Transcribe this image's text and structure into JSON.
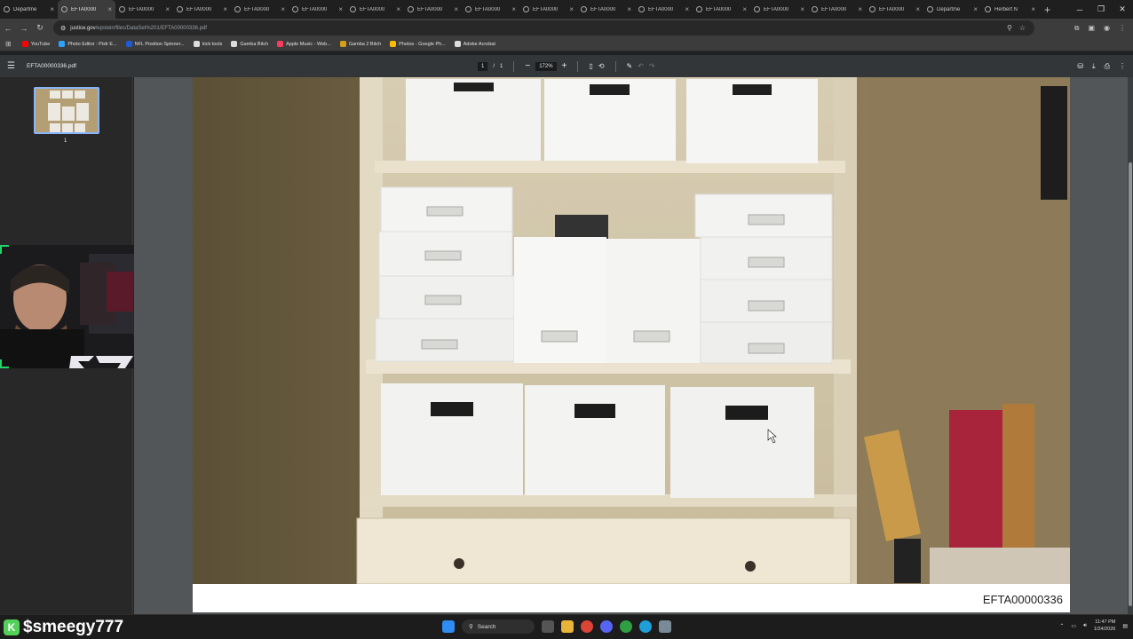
{
  "browser": {
    "tabs": [
      {
        "title": "Departme"
      },
      {
        "title": "EFTA0000"
      },
      {
        "title": "EFTA0000"
      },
      {
        "title": "EFTA0000"
      },
      {
        "title": "EFTA0000"
      },
      {
        "title": "EFTA0000"
      },
      {
        "title": "EFTA0000"
      },
      {
        "title": "EFTA0000"
      },
      {
        "title": "EFTA0000"
      },
      {
        "title": "EFTA0000"
      },
      {
        "title": "EFTA0000"
      },
      {
        "title": "EFTA0000"
      },
      {
        "title": "EFTA0000"
      },
      {
        "title": "EFTA0000"
      },
      {
        "title": "EFTA0000"
      },
      {
        "title": "EFTA0000"
      },
      {
        "title": "Departme"
      },
      {
        "title": "Herbert N"
      }
    ],
    "active_tab_index": 1,
    "url_domain": "justice.gov",
    "url_path": "/epstein/files/DataSet%201/EFTA00000336.pdf",
    "bookmarks": [
      {
        "label": "YouTube",
        "color": "#ff0000"
      },
      {
        "label": "Photo Editor : Pixlr E...",
        "color": "#2aa3ff"
      },
      {
        "label": "NFL Position Spinner...",
        "color": "#1e5bd6"
      },
      {
        "label": "kick tools",
        "color": "#dddddd"
      },
      {
        "label": "Gamba Bitch",
        "color": "#dddddd"
      },
      {
        "label": "Apple Music - Web...",
        "color": "#fa3b5b"
      },
      {
        "label": "Gamba 2 Bitch",
        "color": "#d4a017"
      },
      {
        "label": "Photos - Google Ph...",
        "color": "#fbbc05"
      },
      {
        "label": "Adobe Acrobat",
        "color": "#dddddd"
      }
    ]
  },
  "pdf": {
    "filename": "EFTA00000336.pdf",
    "current_page": "1",
    "page_separator": "/",
    "total_pages": "1",
    "zoom": "172%",
    "thumbnail_label": "1",
    "page_footer_label": "EFTA00000336"
  },
  "stream": {
    "webcam_counter": "5",
    "channel_name": "$smeegy777"
  },
  "taskbar": {
    "search_placeholder": "Search",
    "time": "11:47 PM",
    "date": "1/24/2026"
  },
  "colors": {
    "accent_blue": "#8ab4f8",
    "stream_green": "#22d36a",
    "chrome_dark": "#1f1f1f",
    "pdf_bar": "#323639"
  }
}
